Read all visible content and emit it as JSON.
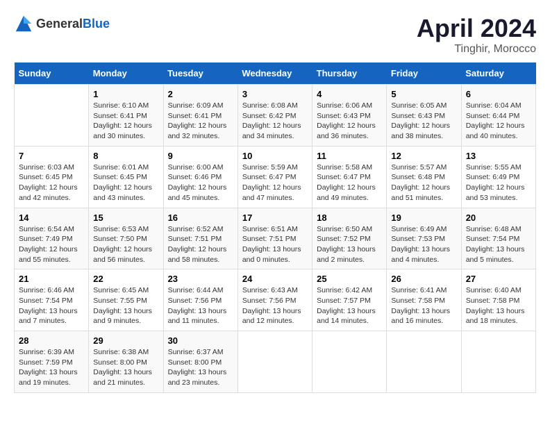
{
  "header": {
    "logo_general": "General",
    "logo_blue": "Blue",
    "title": "April 2024",
    "subtitle": "Tinghir, Morocco"
  },
  "calendar": {
    "days_of_week": [
      "Sunday",
      "Monday",
      "Tuesday",
      "Wednesday",
      "Thursday",
      "Friday",
      "Saturday"
    ],
    "weeks": [
      [
        {
          "day": "",
          "sunrise": "",
          "sunset": "",
          "daylight": ""
        },
        {
          "day": "1",
          "sunrise": "Sunrise: 6:10 AM",
          "sunset": "Sunset: 6:41 PM",
          "daylight": "Daylight: 12 hours and 30 minutes."
        },
        {
          "day": "2",
          "sunrise": "Sunrise: 6:09 AM",
          "sunset": "Sunset: 6:41 PM",
          "daylight": "Daylight: 12 hours and 32 minutes."
        },
        {
          "day": "3",
          "sunrise": "Sunrise: 6:08 AM",
          "sunset": "Sunset: 6:42 PM",
          "daylight": "Daylight: 12 hours and 34 minutes."
        },
        {
          "day": "4",
          "sunrise": "Sunrise: 6:06 AM",
          "sunset": "Sunset: 6:43 PM",
          "daylight": "Daylight: 12 hours and 36 minutes."
        },
        {
          "day": "5",
          "sunrise": "Sunrise: 6:05 AM",
          "sunset": "Sunset: 6:43 PM",
          "daylight": "Daylight: 12 hours and 38 minutes."
        },
        {
          "day": "6",
          "sunrise": "Sunrise: 6:04 AM",
          "sunset": "Sunset: 6:44 PM",
          "daylight": "Daylight: 12 hours and 40 minutes."
        }
      ],
      [
        {
          "day": "7",
          "sunrise": "Sunrise: 6:03 AM",
          "sunset": "Sunset: 6:45 PM",
          "daylight": "Daylight: 12 hours and 42 minutes."
        },
        {
          "day": "8",
          "sunrise": "Sunrise: 6:01 AM",
          "sunset": "Sunset: 6:45 PM",
          "daylight": "Daylight: 12 hours and 43 minutes."
        },
        {
          "day": "9",
          "sunrise": "Sunrise: 6:00 AM",
          "sunset": "Sunset: 6:46 PM",
          "daylight": "Daylight: 12 hours and 45 minutes."
        },
        {
          "day": "10",
          "sunrise": "Sunrise: 5:59 AM",
          "sunset": "Sunset: 6:47 PM",
          "daylight": "Daylight: 12 hours and 47 minutes."
        },
        {
          "day": "11",
          "sunrise": "Sunrise: 5:58 AM",
          "sunset": "Sunset: 6:47 PM",
          "daylight": "Daylight: 12 hours and 49 minutes."
        },
        {
          "day": "12",
          "sunrise": "Sunrise: 5:57 AM",
          "sunset": "Sunset: 6:48 PM",
          "daylight": "Daylight: 12 hours and 51 minutes."
        },
        {
          "day": "13",
          "sunrise": "Sunrise: 5:55 AM",
          "sunset": "Sunset: 6:49 PM",
          "daylight": "Daylight: 12 hours and 53 minutes."
        }
      ],
      [
        {
          "day": "14",
          "sunrise": "Sunrise: 6:54 AM",
          "sunset": "Sunset: 7:49 PM",
          "daylight": "Daylight: 12 hours and 55 minutes."
        },
        {
          "day": "15",
          "sunrise": "Sunrise: 6:53 AM",
          "sunset": "Sunset: 7:50 PM",
          "daylight": "Daylight: 12 hours and 56 minutes."
        },
        {
          "day": "16",
          "sunrise": "Sunrise: 6:52 AM",
          "sunset": "Sunset: 7:51 PM",
          "daylight": "Daylight: 12 hours and 58 minutes."
        },
        {
          "day": "17",
          "sunrise": "Sunrise: 6:51 AM",
          "sunset": "Sunset: 7:51 PM",
          "daylight": "Daylight: 13 hours and 0 minutes."
        },
        {
          "day": "18",
          "sunrise": "Sunrise: 6:50 AM",
          "sunset": "Sunset: 7:52 PM",
          "daylight": "Daylight: 13 hours and 2 minutes."
        },
        {
          "day": "19",
          "sunrise": "Sunrise: 6:49 AM",
          "sunset": "Sunset: 7:53 PM",
          "daylight": "Daylight: 13 hours and 4 minutes."
        },
        {
          "day": "20",
          "sunrise": "Sunrise: 6:48 AM",
          "sunset": "Sunset: 7:54 PM",
          "daylight": "Daylight: 13 hours and 5 minutes."
        }
      ],
      [
        {
          "day": "21",
          "sunrise": "Sunrise: 6:46 AM",
          "sunset": "Sunset: 7:54 PM",
          "daylight": "Daylight: 13 hours and 7 minutes."
        },
        {
          "day": "22",
          "sunrise": "Sunrise: 6:45 AM",
          "sunset": "Sunset: 7:55 PM",
          "daylight": "Daylight: 13 hours and 9 minutes."
        },
        {
          "day": "23",
          "sunrise": "Sunrise: 6:44 AM",
          "sunset": "Sunset: 7:56 PM",
          "daylight": "Daylight: 13 hours and 11 minutes."
        },
        {
          "day": "24",
          "sunrise": "Sunrise: 6:43 AM",
          "sunset": "Sunset: 7:56 PM",
          "daylight": "Daylight: 13 hours and 12 minutes."
        },
        {
          "day": "25",
          "sunrise": "Sunrise: 6:42 AM",
          "sunset": "Sunset: 7:57 PM",
          "daylight": "Daylight: 13 hours and 14 minutes."
        },
        {
          "day": "26",
          "sunrise": "Sunrise: 6:41 AM",
          "sunset": "Sunset: 7:58 PM",
          "daylight": "Daylight: 13 hours and 16 minutes."
        },
        {
          "day": "27",
          "sunrise": "Sunrise: 6:40 AM",
          "sunset": "Sunset: 7:58 PM",
          "daylight": "Daylight: 13 hours and 18 minutes."
        }
      ],
      [
        {
          "day": "28",
          "sunrise": "Sunrise: 6:39 AM",
          "sunset": "Sunset: 7:59 PM",
          "daylight": "Daylight: 13 hours and 19 minutes."
        },
        {
          "day": "29",
          "sunrise": "Sunrise: 6:38 AM",
          "sunset": "Sunset: 8:00 PM",
          "daylight": "Daylight: 13 hours and 21 minutes."
        },
        {
          "day": "30",
          "sunrise": "Sunrise: 6:37 AM",
          "sunset": "Sunset: 8:00 PM",
          "daylight": "Daylight: 13 hours and 23 minutes."
        },
        {
          "day": "",
          "sunrise": "",
          "sunset": "",
          "daylight": ""
        },
        {
          "day": "",
          "sunrise": "",
          "sunset": "",
          "daylight": ""
        },
        {
          "day": "",
          "sunrise": "",
          "sunset": "",
          "daylight": ""
        },
        {
          "day": "",
          "sunrise": "",
          "sunset": "",
          "daylight": ""
        }
      ]
    ]
  }
}
